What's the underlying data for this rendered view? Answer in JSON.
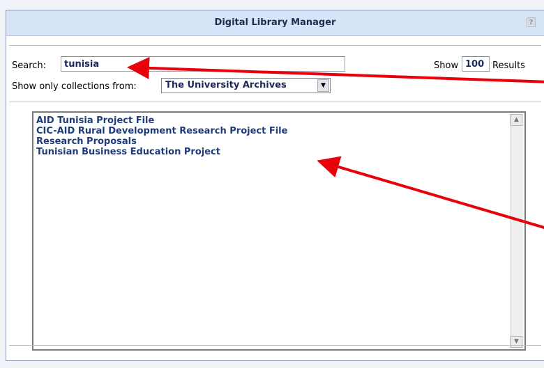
{
  "panel": {
    "title": "Digital Library Manager",
    "help_icon_glyph": "?"
  },
  "search": {
    "label": "Search:",
    "value": "tunisia"
  },
  "results": {
    "show_label": "Show",
    "count_value": "100",
    "results_label": "Results"
  },
  "filter": {
    "label": "Show only collections from:",
    "selected": "The University Archives",
    "dropdown_glyph": "▼"
  },
  "list": {
    "items": [
      "AID Tunisia Project File",
      "CIC-AID Rural Development Research Project File",
      "Research Proposals",
      "Tunisian Business Education Project"
    ]
  },
  "scrollbar": {
    "up_glyph": "▲",
    "down_glyph": "▼"
  },
  "annotation_color": "#e8000b"
}
